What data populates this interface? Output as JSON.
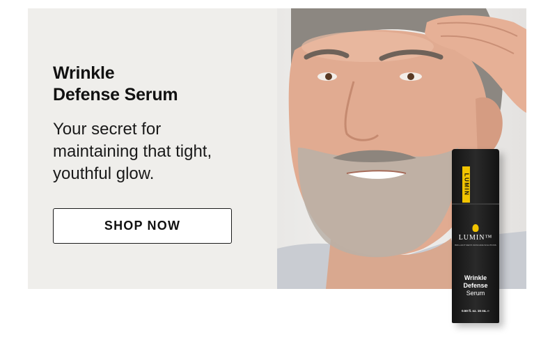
{
  "promo": {
    "title_line1": "Wrinkle",
    "title_line2": "Defense Serum",
    "subtitle_line1": "Your secret for",
    "subtitle_line2": "maintaining that tight,",
    "subtitle_line3": "youthful glow.",
    "button_label": "SHOP NOW"
  },
  "product": {
    "side_label": "LUMIN",
    "brand": "LUMIN™",
    "tagline": "BRILLIANT MEN'S SKINCARE SOLUTIONS",
    "name_line1": "Wrinkle",
    "name_line2": "Defense",
    "name_line3": "Serum",
    "volume": "0.50 fl. oz. 15 mL ℮"
  },
  "colors": {
    "panel_background": "#efeeeb",
    "accent_yellow": "#f2c400",
    "bottle": "#141414"
  }
}
